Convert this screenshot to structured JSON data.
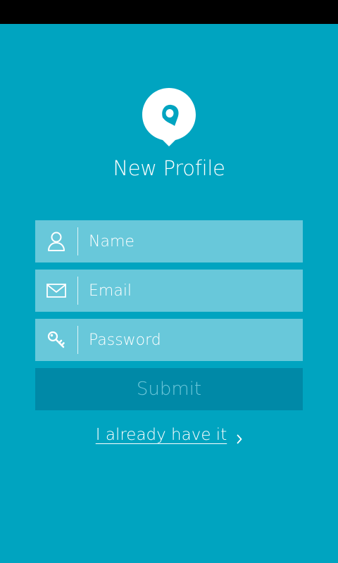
{
  "app": {
    "title": "New Profile"
  },
  "logo": {
    "icon": "chat-bubble-logo-icon"
  },
  "form": {
    "name": {
      "icon": "person-icon",
      "placeholder": "Name",
      "value": ""
    },
    "email": {
      "icon": "envelope-icon",
      "placeholder": "Email",
      "value": ""
    },
    "password": {
      "icon": "key-icon",
      "placeholder": "Password",
      "value": ""
    },
    "submit_label": "Submit"
  },
  "footer": {
    "login_link_label": "I already have it",
    "login_link_icon": "chevron-right-icon"
  },
  "colors": {
    "background": "#00a4c0",
    "field_background": "#68c8da",
    "submit_background": "#0089a7",
    "submit_text": "#6cc7da",
    "text": "#ffffff"
  }
}
